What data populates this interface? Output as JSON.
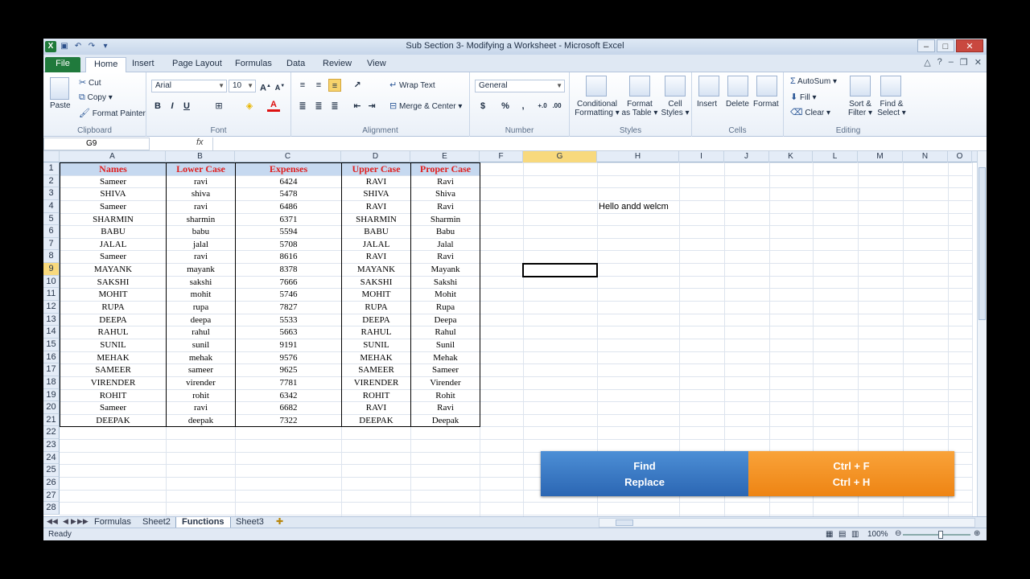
{
  "window": {
    "title": "Sub Section 3- Modifying a Worksheet - Microsoft Excel"
  },
  "tabs": [
    "File",
    "Home",
    "Insert",
    "Page Layout",
    "Formulas",
    "Data",
    "Review",
    "View"
  ],
  "ribbon": {
    "clipboard": {
      "label": "Clipboard",
      "paste": "Paste",
      "cut": "Cut",
      "copy": "Copy",
      "format_painter": "Format Painter"
    },
    "font": {
      "label": "Font",
      "name": "Arial",
      "size": "10",
      "bold": "B",
      "italic": "I",
      "underline": "U"
    },
    "alignment": {
      "label": "Alignment",
      "wrap_text": "Wrap Text",
      "merge_center": "Merge & Center"
    },
    "number": {
      "label": "Number",
      "format": "General",
      "currency": "$",
      "percent": "%",
      "comma": ","
    },
    "styles": {
      "label": "Styles",
      "conditional": "Conditional",
      "formatting": "Formatting",
      "format": "Format",
      "as_table": "as Table",
      "cell": "Cell",
      "cell_styles": "Styles"
    },
    "cells": {
      "label": "Cells",
      "insert": "Insert",
      "delete": "Delete",
      "format": "Format"
    },
    "editing": {
      "label": "Editing",
      "autosum": "AutoSum",
      "fill": "Fill",
      "clear": "Clear",
      "sort": "Sort &",
      "filter": "Filter",
      "find": "Find &",
      "select": "Select"
    }
  },
  "formula_bar": {
    "name_box": "G9",
    "fx": "fx",
    "value": ""
  },
  "columns": [
    "A",
    "B",
    "C",
    "D",
    "E",
    "F",
    "G",
    "H",
    "I",
    "J",
    "K",
    "L",
    "M",
    "N",
    "O"
  ],
  "table": {
    "headers": [
      "Names",
      "Lower Case",
      "Expenses",
      "Upper Case",
      "Proper Case"
    ],
    "rows": [
      [
        "Sameer",
        "ravi",
        "6424",
        "RAVI",
        "Ravi"
      ],
      [
        "SHIVA",
        "shiva",
        "5478",
        "SHIVA",
        "Shiva"
      ],
      [
        "Sameer",
        "ravi",
        "6486",
        "RAVI",
        "Ravi"
      ],
      [
        "SHARMIN",
        "sharmin",
        "6371",
        "SHARMIN",
        "Sharmin"
      ],
      [
        "BABU",
        "babu",
        "5594",
        "BABU",
        "Babu"
      ],
      [
        "JALAL",
        "jalal",
        "5708",
        "JALAL",
        "Jalal"
      ],
      [
        "Sameer",
        "ravi",
        "8616",
        "RAVI",
        "Ravi"
      ],
      [
        "MAYANK",
        "mayank",
        "8378",
        "MAYANK",
        "Mayank"
      ],
      [
        "SAKSHI",
        "sakshi",
        "7666",
        "SAKSHI",
        "Sakshi"
      ],
      [
        "MOHIT",
        "mohit",
        "5746",
        "MOHIT",
        "Mohit"
      ],
      [
        "RUPA",
        "rupa",
        "7827",
        "RUPA",
        "Rupa"
      ],
      [
        "DEEPA",
        "deepa",
        "5533",
        "DEEPA",
        "Deepa"
      ],
      [
        "RAHUL",
        "rahul",
        "5663",
        "RAHUL",
        "Rahul"
      ],
      [
        "SUNIL",
        "sunil",
        "9191",
        "SUNIL",
        "Sunil"
      ],
      [
        "MEHAK",
        "mehak",
        "9576",
        "MEHAK",
        "Mehak"
      ],
      [
        "SAMEER",
        "sameer",
        "9625",
        "SAMEER",
        "Sameer"
      ],
      [
        "VIRENDER",
        "virender",
        "7781",
        "VIRENDER",
        "Virender"
      ],
      [
        "ROHIT",
        "rohit",
        "6342",
        "ROHIT",
        "Rohit"
      ],
      [
        "Sameer",
        "ravi",
        "6682",
        "RAVI",
        "Ravi"
      ],
      [
        "DEEPAK",
        "deepak",
        "7322",
        "DEEPAK",
        "Deepak"
      ]
    ]
  },
  "row_numbers": [
    "1",
    "2",
    "3",
    "4",
    "5",
    "6",
    "7",
    "8",
    "9",
    "10",
    "11",
    "12",
    "13",
    "14",
    "15",
    "16",
    "17",
    "18",
    "19",
    "20",
    "21",
    "22",
    "23",
    "24",
    "25",
    "26",
    "27",
    "28"
  ],
  "note_cell": {
    "text": "Hello andd welcm"
  },
  "banner": {
    "left_line1": "Find",
    "left_line2": "Replace",
    "right_line1": "Ctrl + F",
    "right_line2": "Ctrl + H"
  },
  "sheets": [
    "Formulas",
    "Sheet2",
    "Functions",
    "Sheet3"
  ],
  "active_sheet": "Functions",
  "status": {
    "ready": "Ready",
    "zoom": "100%"
  }
}
